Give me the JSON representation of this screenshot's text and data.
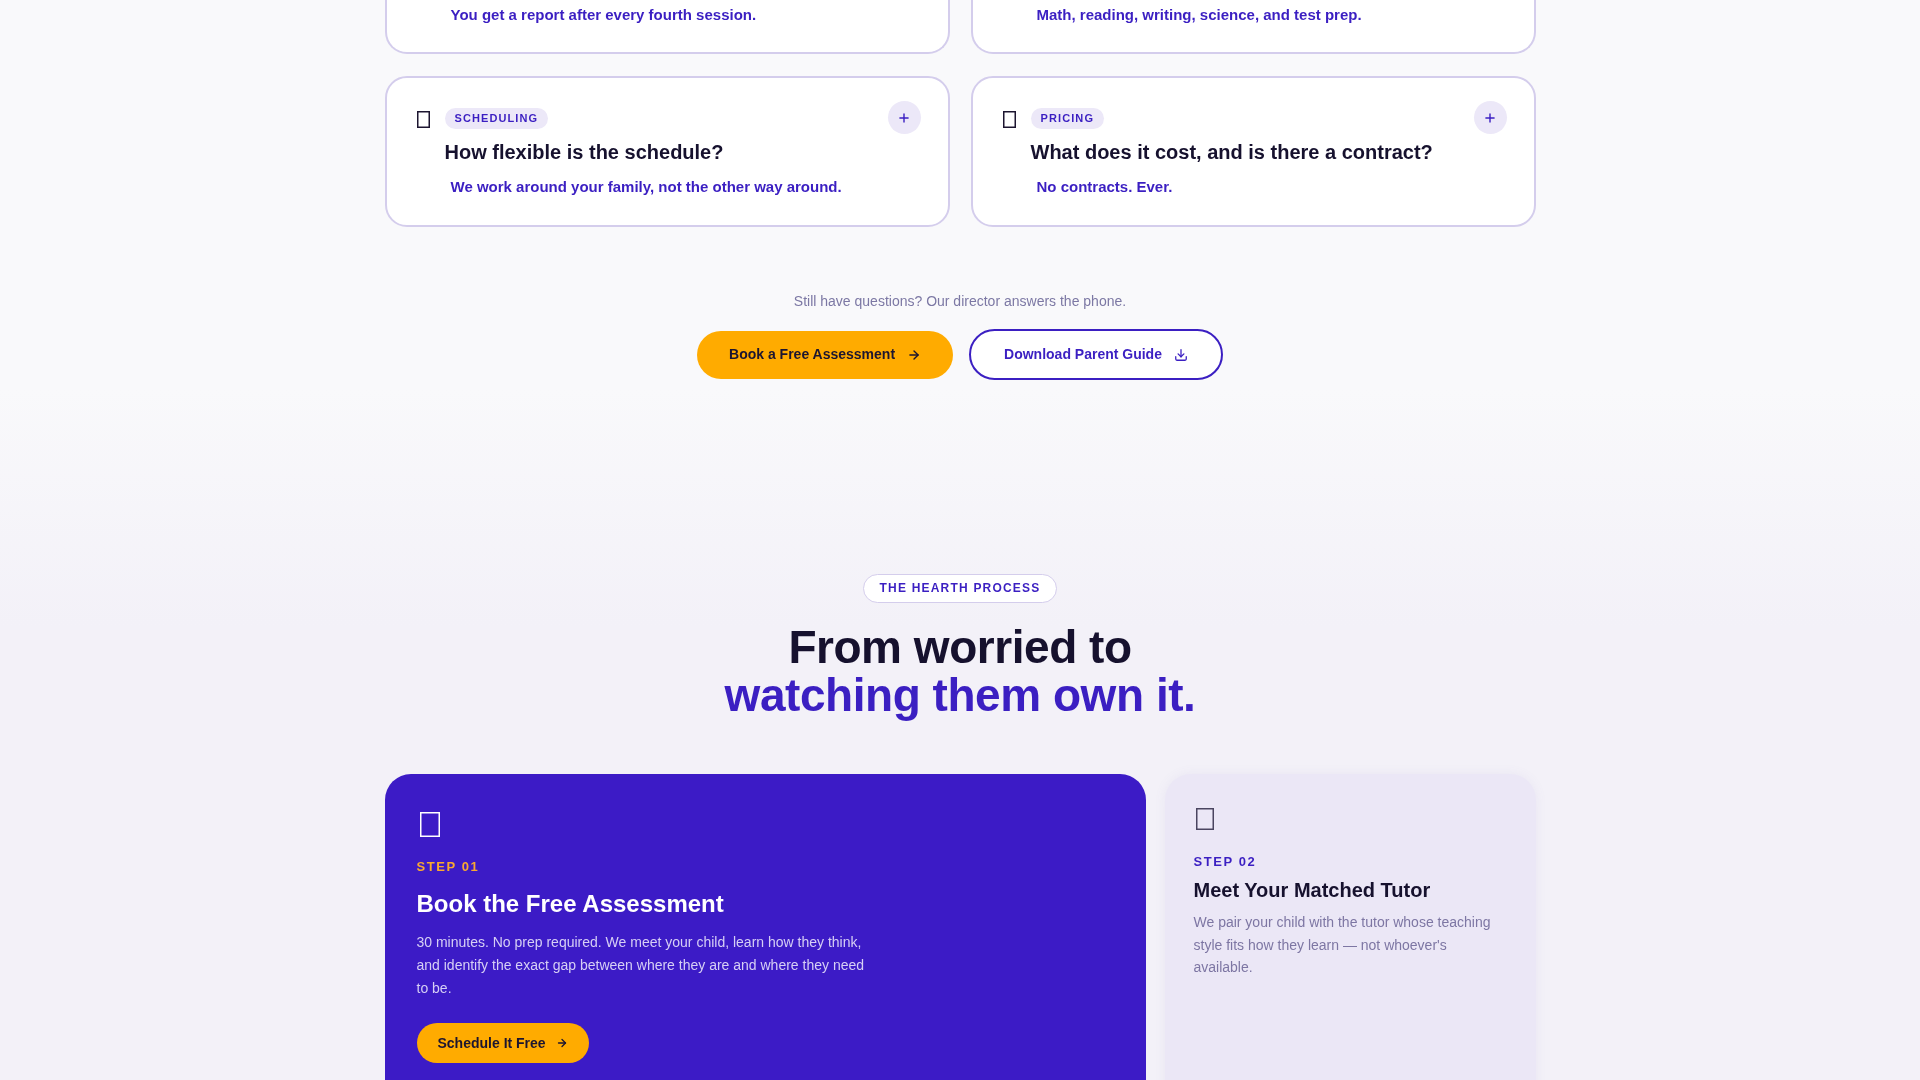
{
  "faq": {
    "items": [
      {
        "kind": "partial",
        "answer": "You get a report after every fourth session."
      },
      {
        "kind": "partial",
        "answer": "Math, reading, writing, science, and test prep."
      },
      {
        "kind": "full",
        "category": "SCHEDULING",
        "question": "How flexible is the schedule?",
        "answer": "We work around your family, not the other way around."
      },
      {
        "kind": "full",
        "category": "PRICING",
        "question": "What does it cost, and is there a contract?",
        "answer": "No contracts. Ever."
      }
    ]
  },
  "cta": {
    "note": "Still have questions? Our director answers the phone.",
    "buttons": [
      {
        "kind": "primary",
        "label": "Book a Free Assessment"
      },
      {
        "kind": "outline",
        "label": "Download Parent Guide"
      }
    ]
  },
  "process": {
    "badge": "THE HEARTH PROCESS",
    "heading": "From worried to",
    "heading_highlight": "watching them own it.",
    "steps": [
      {
        "kind": "featured",
        "step": "STEP 01",
        "title": "Book the Free Assessment",
        "body": "30 minutes. No prep required. We meet your child, learn how they think, and identify the exact gap between where they are and where they need to be.",
        "button": "Schedule It Free"
      },
      {
        "kind": "plain",
        "step": "STEP 02",
        "title": "Meet Your Matched Tutor",
        "body": "We pair your child with the tutor whose teaching style fits how they learn — not whoever's available."
      }
    ]
  }
}
